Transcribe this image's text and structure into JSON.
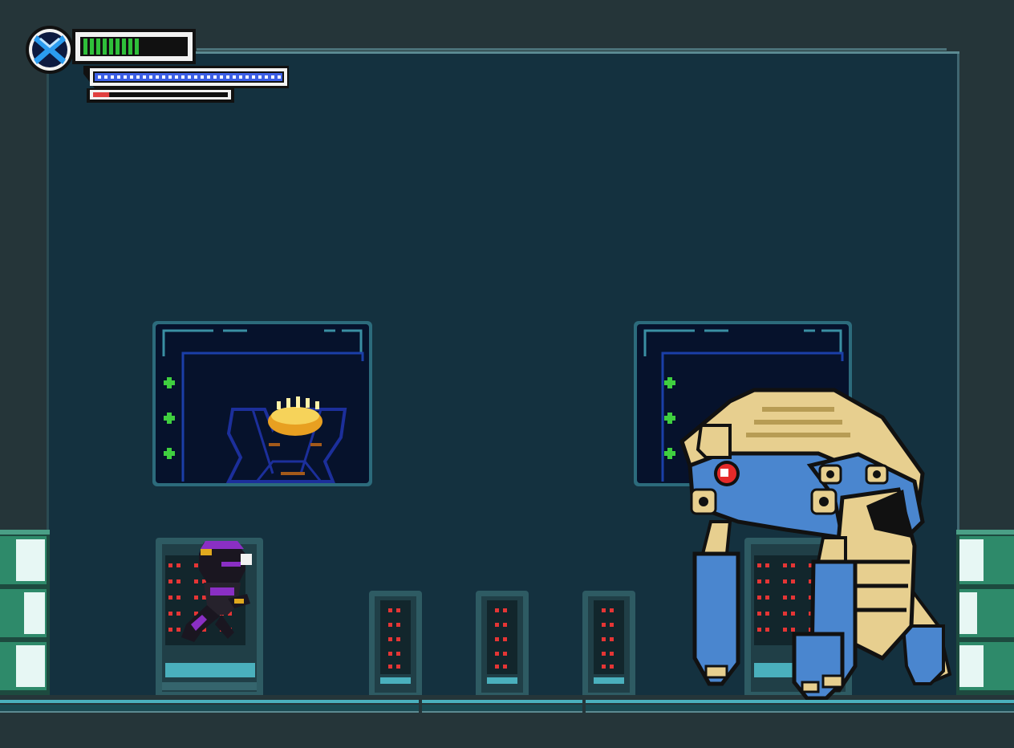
{
  "hud": {
    "emblem_icon": "x-emblem-icon",
    "health": {
      "filled_segments": 9,
      "max_segments": 16,
      "color": "#2fbf3a"
    },
    "weapon_energy": {
      "level": 1.0,
      "color": "#3c5fe6"
    },
    "special_gauge": {
      "level": 0.12,
      "color": "#e04040"
    }
  },
  "colors": {
    "wall": "#14313f",
    "wall_edge": "#5b8a92",
    "outer": "#253539",
    "floor_line": "#4ab0bd",
    "monitor_frame": "#2c6b7c",
    "monitor_screen": "#06122c",
    "led_green": "#3fcf3f",
    "led_red": "#e53535",
    "pipe": "#2e8a6a",
    "boss_gold": "#e7cf8f",
    "boss_blue": "#4a86cf",
    "player_purple": "#8a2fc4"
  },
  "scene": {
    "monitors": [
      {
        "id": "left",
        "content": "hologram-crowned-figure-icon"
      },
      {
        "id": "right",
        "content": "monitor-screen"
      }
    ],
    "server_racks": [
      "rack-large-left",
      "rack-small-1",
      "rack-small-2",
      "rack-small-3",
      "rack-large-right"
    ],
    "player": {
      "icon": "purple-ninja-player-icon"
    },
    "boss": {
      "icon": "gold-blue-mech-boss-icon",
      "eye_color": "#e52a2a"
    }
  }
}
